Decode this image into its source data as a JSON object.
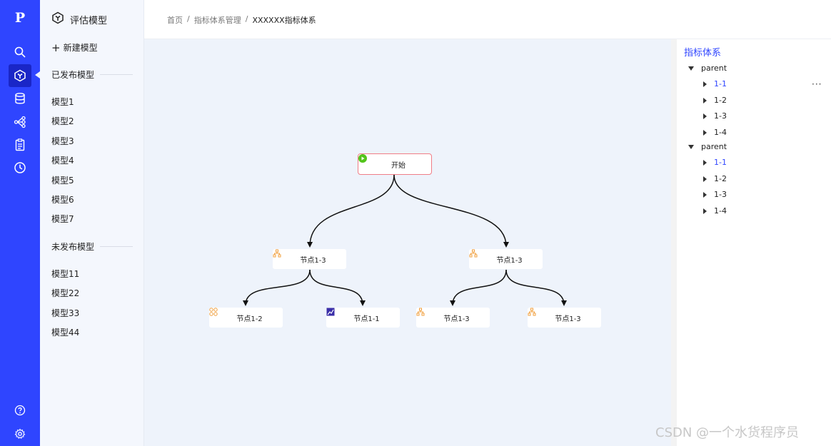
{
  "rail": {
    "logo": "P",
    "icons": [
      "search-icon",
      "model-cube-icon",
      "database-icon",
      "flow-icon",
      "document-icon",
      "clock-icon",
      "help-icon",
      "settings-icon"
    ]
  },
  "nav": {
    "title": "评估模型",
    "new_label": "新建模型",
    "published_title": "已发布模型",
    "published": [
      "模型1",
      "模型2",
      "模型3",
      "模型4",
      "模型5",
      "模型6",
      "模型7"
    ],
    "unpublished_title": "未发布模型",
    "unpublished": [
      "模型11",
      "模型22",
      "模型33",
      "模型44"
    ]
  },
  "breadcrumb": [
    "首页",
    "指标体系管理",
    "XXXXXX指标体系"
  ],
  "breadcrumb_sep": "/",
  "flow": {
    "start": "开始",
    "level1": [
      "节点1-3",
      "节点1-3"
    ],
    "level2": [
      "节点1-2",
      "节点1-1",
      "节点1-3",
      "节点1-3"
    ]
  },
  "tree": {
    "title": "指标体系",
    "more": "···",
    "groups": [
      {
        "label": "parent",
        "children": [
          "1-1",
          "1-2",
          "1-3",
          "1-4"
        ]
      },
      {
        "label": "parent",
        "children": [
          "1-1",
          "1-2",
          "1-3",
          "1-4"
        ]
      }
    ]
  },
  "colors": {
    "accent": "#2f45ff",
    "start_border": "#f07d86",
    "start_icon": "#52c41a",
    "node_icon": "#f0a040"
  },
  "watermark": "CSDN @一个水货程序员"
}
